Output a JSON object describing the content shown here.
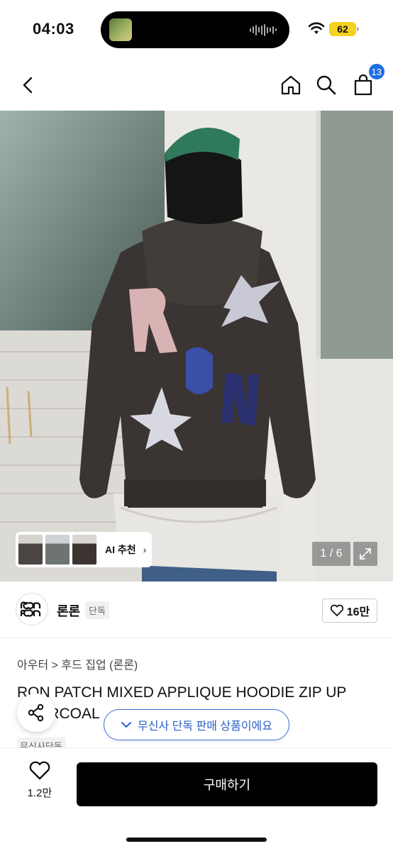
{
  "status_bar": {
    "time": "04:03",
    "battery": "62"
  },
  "header": {
    "cart_count": "13"
  },
  "gallery": {
    "ai_label": "AI 추천",
    "counter": "1 / 6"
  },
  "brand": {
    "name": "론론",
    "tag": "단독",
    "like_count": "16만"
  },
  "product": {
    "breadcrumb": "아우터 > 후드 집업 (론론)",
    "title": "RON PATCH MIXED APPLIQUE HOODIE ZIP UP CHARCOAL",
    "exclusive_tag": "무신사단독"
  },
  "toast": {
    "text": "무신사 단독 판매 상품이에요"
  },
  "bottom_bar": {
    "wish_count": "1.2만",
    "buy_label": "구매하기"
  },
  "colors": {
    "accent_blue": "#1f6de6",
    "buy_button": "#000000",
    "hoodie": "#3a3533"
  }
}
